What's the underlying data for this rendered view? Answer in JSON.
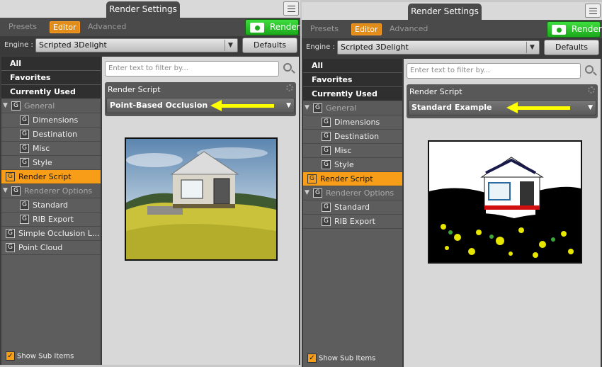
{
  "left": {
    "title": "Render Settings",
    "tabs": [
      "Presets",
      "Editor",
      "Advanced"
    ],
    "render_label": "Render",
    "engine_label": "Engine :",
    "engine_value": "Scripted 3Delight",
    "defaults_label": "Defaults",
    "filter_placeholder": "Enter text to filter by...",
    "sidebar": {
      "all": "All",
      "favorites": "Favorites",
      "currently_used": "Currently Used",
      "general": "General",
      "dimensions": "Dimensions",
      "destination": "Destination",
      "misc": "Misc",
      "style": "Style",
      "render_script": "Render Script",
      "renderer_options": "Renderer Options",
      "standard": "Standard",
      "rib_export": "RIB Export",
      "simple_occlusion": "Simple Occlusion L...",
      "point_cloud": "Point Cloud",
      "g_icon": "G"
    },
    "show_sub_items": "Show Sub Items",
    "render_script_heading": "Render Script",
    "render_script_value": "Point-Based Occlusion"
  },
  "right": {
    "title": "Render Settings",
    "tabs": [
      "Presets",
      "Editor",
      "Advanced"
    ],
    "render_label": "Render",
    "engine_label": "Engine :",
    "engine_value": "Scripted 3Delight",
    "defaults_label": "Defaults",
    "filter_placeholder": "Enter text to filter by...",
    "sidebar": {
      "all": "All",
      "favorites": "Favorites",
      "currently_used": "Currently Used",
      "general": "General",
      "dimensions": "Dimensions",
      "destination": "Destination",
      "misc": "Misc",
      "style": "Style",
      "render_script": "Render Script",
      "renderer_options": "Renderer Options",
      "standard": "Standard",
      "rib_export": "RIB Export",
      "g_icon": "G"
    },
    "show_sub_items": "Show Sub Items",
    "render_script_heading": "Render Script",
    "render_script_value": "Standard Example"
  },
  "colors": {
    "accent_orange": "#f89d18",
    "render_green": "#1ba91b",
    "arrow_yellow": "#ffff00"
  }
}
